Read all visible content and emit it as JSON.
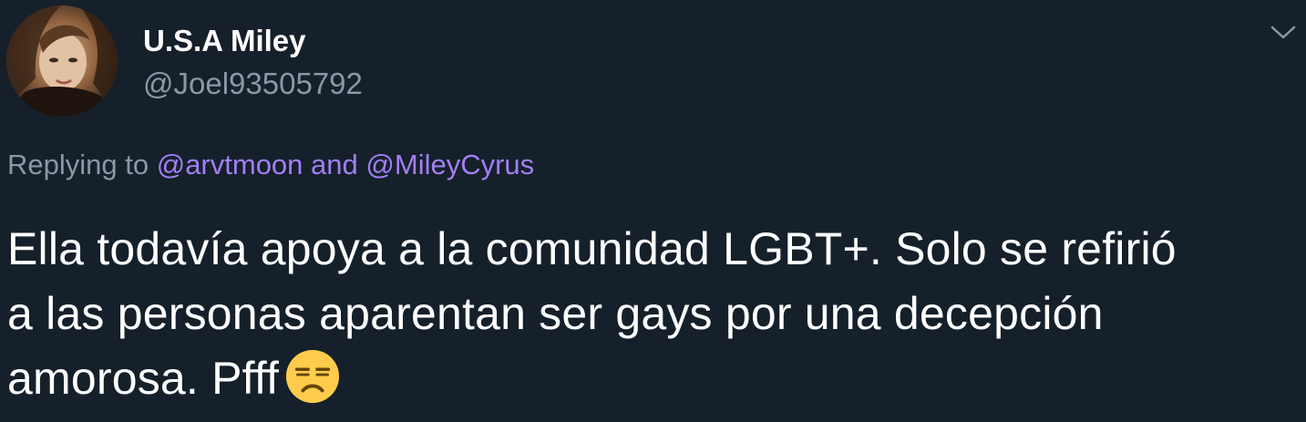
{
  "tweet": {
    "author": {
      "display_name": "U.S.A Miley",
      "handle": "@Joel93505792",
      "avatar_icon": "user-avatar"
    },
    "menu_icon": "chevron-down-icon",
    "reply_context": {
      "prefix": "Replying to",
      "mention_1": "@arvtmoon",
      "conjunction": "and",
      "mention_2": "@MileyCyrus"
    },
    "text_lines": [
      "Ella todavía apoya a la comunidad LGBT+. Solo se refirió",
      "a las personas aparentan ser gays por una decepción",
      "amorosa. Pfff"
    ],
    "emoji": "unamused-face-emoji"
  },
  "colors": {
    "background": "#15202b",
    "primary_text": "#ffffff",
    "secondary_text": "#8899a6",
    "mention": "#a17ff2"
  }
}
